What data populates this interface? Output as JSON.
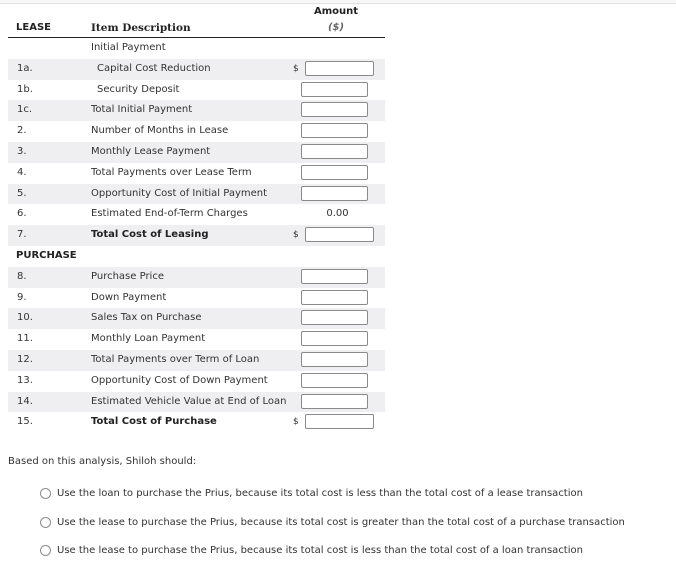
{
  "header": {
    "section_lease": "LEASE",
    "item_description": "Item Description",
    "amount": "Amount",
    "amount_unit": "($)"
  },
  "lease_rows": [
    {
      "num": "",
      "desc": "Initial Payment",
      "input": false,
      "shaded": false
    },
    {
      "num": "1a.",
      "desc": "Capital Cost Reduction",
      "input": true,
      "dollar": "$",
      "indent": true,
      "shaded": true,
      "value": ""
    },
    {
      "num": "1b.",
      "desc": "Security Deposit",
      "input": true,
      "indent": true,
      "shaded": false,
      "value": ""
    },
    {
      "num": "1c.",
      "desc": "Total Initial Payment",
      "input": true,
      "shaded": true,
      "value": ""
    },
    {
      "num": "2.",
      "desc": "Number of Months in Lease",
      "input": true,
      "shaded": false,
      "value": ""
    },
    {
      "num": "3.",
      "desc": "Monthly Lease Payment",
      "input": true,
      "shaded": true,
      "value": ""
    },
    {
      "num": "4.",
      "desc": "Total Payments over Lease Term",
      "input": true,
      "shaded": false,
      "value": ""
    },
    {
      "num": "5.",
      "desc": "Opportunity Cost of Initial Payment",
      "input": true,
      "shaded": true,
      "value": ""
    },
    {
      "num": "6.",
      "desc": "Estimated End-of-Term Charges",
      "input": false,
      "static_value": "0.00",
      "shaded": false
    },
    {
      "num": "7.",
      "desc": "Total Cost of Leasing",
      "input": true,
      "dollar": "$",
      "bold": true,
      "shaded": true,
      "value": ""
    }
  ],
  "section_purchase": "PURCHASE",
  "purchase_rows": [
    {
      "num": "8.",
      "desc": "Purchase Price",
      "input": true,
      "shaded": true,
      "value": ""
    },
    {
      "num": "9.",
      "desc": "Down Payment",
      "input": true,
      "shaded": false,
      "value": ""
    },
    {
      "num": "10.",
      "desc": "Sales Tax on Purchase",
      "input": true,
      "shaded": true,
      "value": ""
    },
    {
      "num": "11.",
      "desc": "Monthly Loan Payment",
      "input": true,
      "shaded": false,
      "value": ""
    },
    {
      "num": "12.",
      "desc": "Total Payments over Term of Loan",
      "input": true,
      "shaded": true,
      "value": ""
    },
    {
      "num": "13.",
      "desc": "Opportunity Cost of Down Payment",
      "input": true,
      "shaded": false,
      "value": ""
    },
    {
      "num": "14.",
      "desc": "Estimated Vehicle Value at End of Loan",
      "input": true,
      "shaded": true,
      "value": ""
    },
    {
      "num": "15.",
      "desc": "Total Cost of Purchase",
      "input": true,
      "dollar": "$",
      "bold": true,
      "shaded": false,
      "value": ""
    }
  ],
  "question": "Based on this analysis, Shiloh should:",
  "options": [
    {
      "label": "Use the loan to purchase the Prius, because its total cost is less than the total cost of a lease transaction",
      "selected": false
    },
    {
      "label": "Use the lease to purchase the Prius, because its total cost is greater than the total cost of a purchase transaction",
      "selected": false
    },
    {
      "label": "Use the lease to purchase the Prius, because its total cost is less than the total cost of a loan transaction",
      "selected": false
    }
  ]
}
